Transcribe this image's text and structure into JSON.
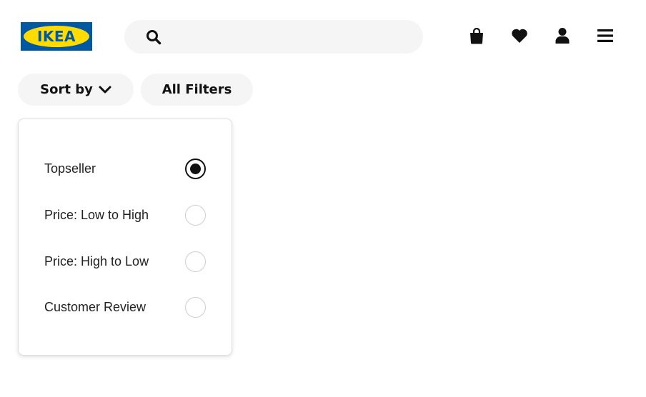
{
  "header": {
    "logo_text": "IKEA",
    "search": {
      "value": "",
      "placeholder": ""
    },
    "icons": [
      "shopping-bag-icon",
      "heart-icon",
      "user-icon",
      "menu-icon"
    ]
  },
  "toolbar": {
    "sort_label": "Sort by",
    "filters_label": "All Filters"
  },
  "sort_menu": {
    "options": [
      {
        "label": "Topseller",
        "selected": true
      },
      {
        "label": "Price: Low to High",
        "selected": false
      },
      {
        "label": "Price: High to Low",
        "selected": false
      },
      {
        "label": "Customer Review",
        "selected": false
      }
    ]
  },
  "colors": {
    "brand_blue": "#0058a3",
    "brand_yellow": "#ffdb00",
    "pill_bg": "#f5f5f5"
  }
}
